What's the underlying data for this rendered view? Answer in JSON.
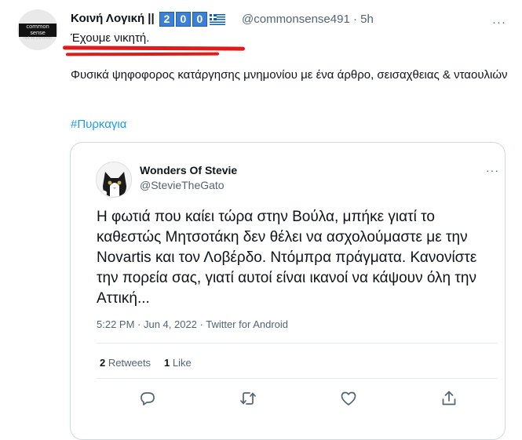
{
  "tweet": {
    "author_name": "Κοινή Λογική ||",
    "badge_digits": [
      "2",
      "0",
      "0"
    ],
    "handle_time": "@commonsense491 · 5h",
    "avatar_text_line1": "common sense",
    "avatar_text_line2": "not so common",
    "line1": "Έχουμε νικητή.",
    "body": "Φυσικά ψηφοφορος κατάργησης μνημονίου με ένα άρθρο, σεισαχθειας & νταουλιών",
    "hashtag": "#Πυρκαγια",
    "more_label": "···"
  },
  "quoted": {
    "author_name": "Wonders Of Stevie",
    "handle": "@StevieTheGato",
    "more_label": "···",
    "text": "Η φωτιά που καίει τώρα στην Βούλα, μπήκε γιατί το καθεστώς Μητσοτάκη δεν θέλει να ασχολούμαστε με την Novartis και τον Λοβέρδο. Ντόμπρα πράγματα. Κανονίστε την πορεία σας, γιατί αυτοί είναι ικανοί να κάψουν όλη την Αττική...",
    "meta": "5:22 PM · Jun 4, 2022 · Twitter for Android",
    "retweets_count": "2",
    "retweets_label": "Retweets",
    "likes_count": "1",
    "likes_label": "Like"
  },
  "actions": [
    "reply-icon",
    "retweet-icon",
    "like-icon",
    "share-icon"
  ],
  "colors": {
    "accent": "#1d9bf0",
    "annotation": "#e01b1b",
    "secondary_text": "#536471"
  }
}
